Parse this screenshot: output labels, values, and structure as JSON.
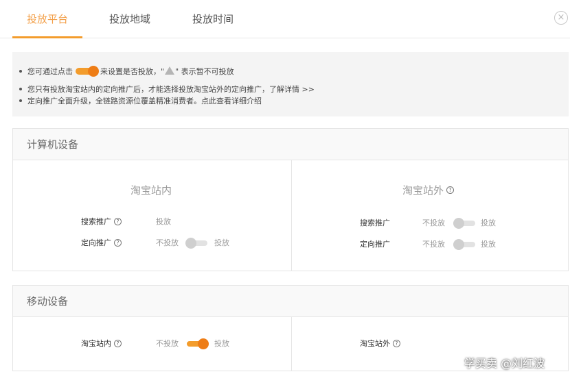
{
  "tabs": [
    {
      "label": "投放平台",
      "active": true
    },
    {
      "label": "投放地域",
      "active": false
    },
    {
      "label": "投放时间",
      "active": false
    }
  ],
  "close_glyph": "×",
  "info": {
    "line1_prefix": "您可通过点击",
    "line1_middle": "来设置是否投放，\"",
    "line1_suffix": "\" 表示暂不可投放",
    "line2_text": "您只有投放淘宝站内的定向推广后，才能选择投放淘宝站外的定向推广，",
    "line2_link": "了解详情 >>",
    "line3_text": "定向推广全面升级，全链路资源位覆盖精准消费者。",
    "line3_link": "点此查看详细介绍"
  },
  "computer": {
    "title": "计算机设备",
    "left": {
      "title": "淘宝站内",
      "rows": [
        {
          "label": "搜索推广",
          "value": "投放"
        },
        {
          "label": "定向推广",
          "off_label": "不投放",
          "on_label": "投放",
          "state": "off"
        }
      ]
    },
    "right": {
      "title": "淘宝站外",
      "rows": [
        {
          "label": "搜索推广",
          "off_label": "不投放",
          "on_label": "投放",
          "state": "off"
        },
        {
          "label": "定向推广",
          "off_label": "不投放",
          "on_label": "投放",
          "state": "off"
        }
      ]
    }
  },
  "mobile": {
    "title": "移动设备",
    "left": {
      "label": "淘宝站内",
      "off_label": "不投放",
      "on_label": "投放",
      "state": "on"
    },
    "right": {
      "label": "淘宝站外"
    }
  },
  "watermark": "学买卖 @刘红波",
  "colors": {
    "accent": "#f39c2c",
    "toggle_on": "#ee7d16",
    "toggle_off": "#cfcfcf"
  },
  "icons": {
    "help": "help-circle-icon",
    "warning": "warning-triangle-icon",
    "close": "close-circle-icon"
  }
}
